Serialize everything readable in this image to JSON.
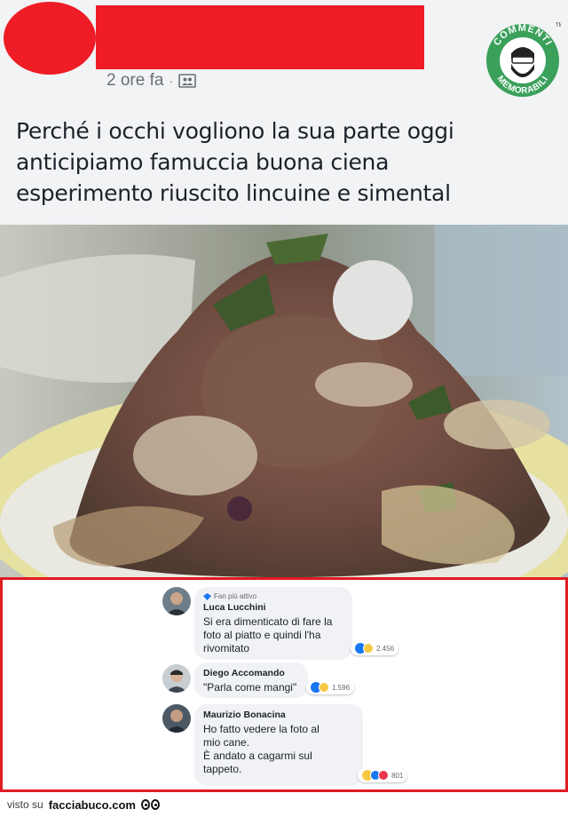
{
  "post": {
    "time": "2 ore fa",
    "separator": "·",
    "text_lines": [
      "Perché i occhi vogliono la sua parte oggi",
      "anticipiamo famuccia buona ciena",
      "esperimento riuscito lincuine e simental"
    ]
  },
  "logo": {
    "top_text": "COMMENTI",
    "bottom_text": "MEMORABILI",
    "tm": "TM",
    "color": "#3aa05a"
  },
  "comments": [
    {
      "badge": "Fan più attivo",
      "name": "Luca Lucchini",
      "lines": [
        "Si era dimenticato di fare la",
        "foto al piatto e quindi l'ha",
        "rivomitato"
      ],
      "reaction_count": "2.456"
    },
    {
      "name": "Diego Accomando",
      "lines": [
        "\"Parla come mangi\""
      ],
      "reaction_count": "1.596"
    },
    {
      "name": "Maurizio Bonacina",
      "lines": [
        "Ho fatto vedere la foto al",
        "mio cane.",
        "È andato a cagarmi sul",
        "tappeto."
      ],
      "reaction_count": "801"
    }
  ],
  "footer": {
    "prefix": "visto su",
    "site": "facciabuco.com"
  },
  "colors": {
    "redaction": "#ee1c25",
    "panel_border": "#e01b22",
    "like_blue": "#1877f2"
  }
}
